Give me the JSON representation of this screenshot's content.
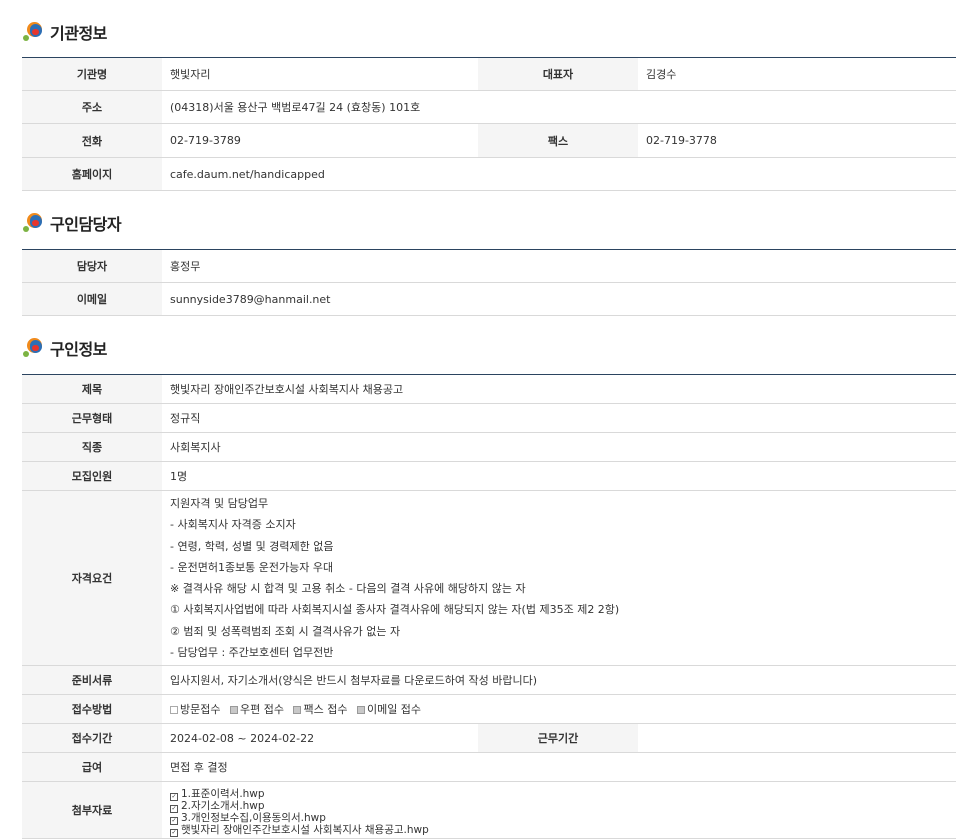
{
  "org": {
    "title": "기관정보",
    "rows": {
      "name_label": "기관명",
      "name": "햇빛자리",
      "rep_label": "대표자",
      "rep": "김경수",
      "addr_label": "주소",
      "addr": "(04318)서울 용산구 백범로47길 24 (효창동) 101호",
      "tel_label": "전화",
      "tel": "02-719-3789",
      "fax_label": "팩스",
      "fax": "02-719-3778",
      "home_label": "홈페이지",
      "home": "cafe.daum.net/handicapped"
    }
  },
  "contact": {
    "title": "구인담당자",
    "manager_label": "담당자",
    "manager": "홍정무",
    "email_label": "이메일",
    "email": "sunnyside3789@hanmail.net"
  },
  "job": {
    "title": "구인정보",
    "subject_label": "제목",
    "subject": "햇빛자리 장애인주간보호시설 사회복지사 채용공고",
    "type_label": "근무형태",
    "type": "정규직",
    "occupation_label": "직종",
    "occupation": "사회복지사",
    "headcount_label": "모집인원",
    "headcount": "1명",
    "qual_label": "자격요건",
    "qual_lines": [
      "지원자격 및 담당업무",
      "- 사회복지사 자격증 소지자",
      "- 연령, 학력, 성별 및 경력제한 없음",
      "- 운전면허1종보통 운전가능자 우대",
      "※ 결격사유 해당 시 합격 및 고용 취소 - 다음의 결격 사유에 해당하지 않는 자",
      "① 사회복지사업법에 따라 사회복지시설 종사자 결격사유에 해당되지 않는 자(법 제35조 제2 2항)",
      "② 범죄 및 성폭력범죄 조회 시 결격사유가 없는 자",
      "- 담당업무 : 주간보호센터 업무전반"
    ],
    "docs_label": "준비서류",
    "docs": "입사지원서, 자기소개서(양식은 반드시 첨부자료를 다운로드하여 작성 바랍니다)",
    "method_label": "접수방법",
    "methods": [
      {
        "label": "방문접수",
        "checked": false
      },
      {
        "label": "우편 접수",
        "checked": true
      },
      {
        "label": "팩스 접수",
        "checked": true
      },
      {
        "label": "이메일 접수",
        "checked": true
      }
    ],
    "period_label": "접수기간",
    "period": "2024-02-08 ~ 2024-02-22",
    "work_period_label": "근무기간",
    "work_period": "",
    "salary_label": "급여",
    "salary": "면접 후 결정",
    "attach_label": "첨부자료",
    "attachments": [
      "1.표준이력서.hwp",
      "2.자기소개서.hwp",
      "3.개인정보수집,이용동의서.hwp",
      "햇빛자리 장애인주간보호시설 사회복지사 채용공고.hwp"
    ]
  }
}
